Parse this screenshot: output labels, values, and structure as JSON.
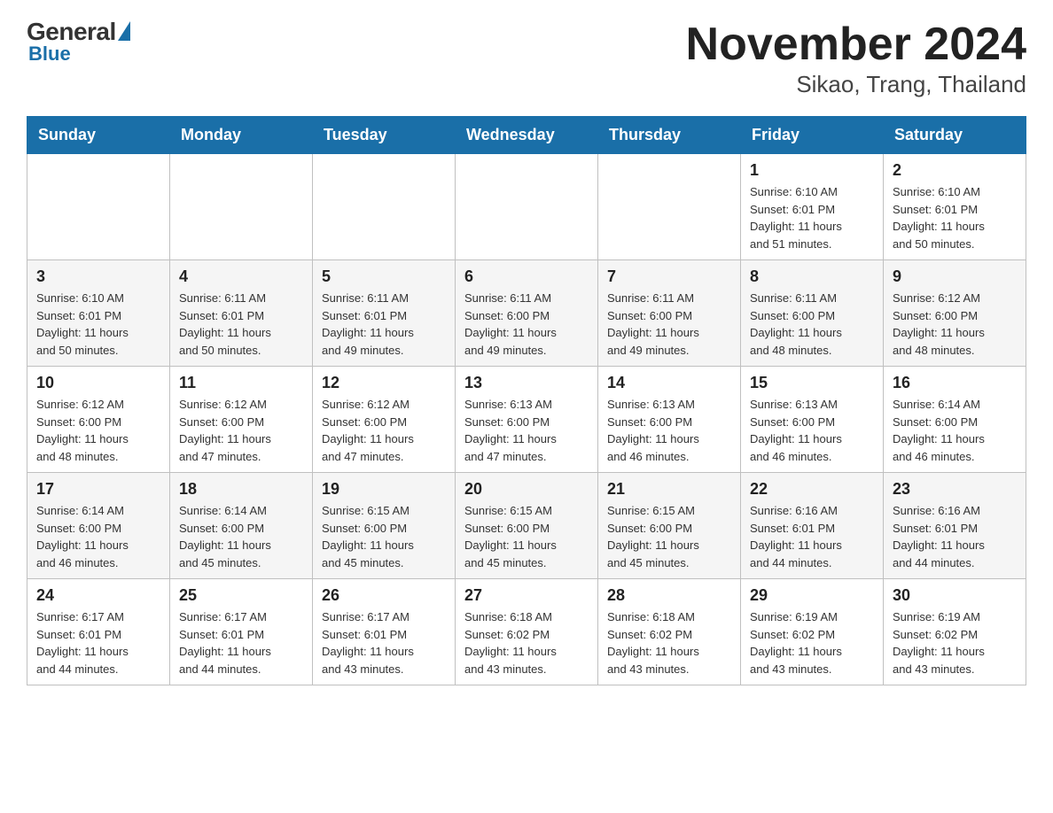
{
  "logo": {
    "general": "General",
    "blue": "Blue",
    "triangle": "▶"
  },
  "title": "November 2024",
  "subtitle": "Sikao, Trang, Thailand",
  "days_of_week": [
    "Sunday",
    "Monday",
    "Tuesday",
    "Wednesday",
    "Thursday",
    "Friday",
    "Saturday"
  ],
  "weeks": [
    [
      {
        "day": "",
        "info": ""
      },
      {
        "day": "",
        "info": ""
      },
      {
        "day": "",
        "info": ""
      },
      {
        "day": "",
        "info": ""
      },
      {
        "day": "",
        "info": ""
      },
      {
        "day": "1",
        "info": "Sunrise: 6:10 AM\nSunset: 6:01 PM\nDaylight: 11 hours\nand 51 minutes."
      },
      {
        "day": "2",
        "info": "Sunrise: 6:10 AM\nSunset: 6:01 PM\nDaylight: 11 hours\nand 50 minutes."
      }
    ],
    [
      {
        "day": "3",
        "info": "Sunrise: 6:10 AM\nSunset: 6:01 PM\nDaylight: 11 hours\nand 50 minutes."
      },
      {
        "day": "4",
        "info": "Sunrise: 6:11 AM\nSunset: 6:01 PM\nDaylight: 11 hours\nand 50 minutes."
      },
      {
        "day": "5",
        "info": "Sunrise: 6:11 AM\nSunset: 6:01 PM\nDaylight: 11 hours\nand 49 minutes."
      },
      {
        "day": "6",
        "info": "Sunrise: 6:11 AM\nSunset: 6:00 PM\nDaylight: 11 hours\nand 49 minutes."
      },
      {
        "day": "7",
        "info": "Sunrise: 6:11 AM\nSunset: 6:00 PM\nDaylight: 11 hours\nand 49 minutes."
      },
      {
        "day": "8",
        "info": "Sunrise: 6:11 AM\nSunset: 6:00 PM\nDaylight: 11 hours\nand 48 minutes."
      },
      {
        "day": "9",
        "info": "Sunrise: 6:12 AM\nSunset: 6:00 PM\nDaylight: 11 hours\nand 48 minutes."
      }
    ],
    [
      {
        "day": "10",
        "info": "Sunrise: 6:12 AM\nSunset: 6:00 PM\nDaylight: 11 hours\nand 48 minutes."
      },
      {
        "day": "11",
        "info": "Sunrise: 6:12 AM\nSunset: 6:00 PM\nDaylight: 11 hours\nand 47 minutes."
      },
      {
        "day": "12",
        "info": "Sunrise: 6:12 AM\nSunset: 6:00 PM\nDaylight: 11 hours\nand 47 minutes."
      },
      {
        "day": "13",
        "info": "Sunrise: 6:13 AM\nSunset: 6:00 PM\nDaylight: 11 hours\nand 47 minutes."
      },
      {
        "day": "14",
        "info": "Sunrise: 6:13 AM\nSunset: 6:00 PM\nDaylight: 11 hours\nand 46 minutes."
      },
      {
        "day": "15",
        "info": "Sunrise: 6:13 AM\nSunset: 6:00 PM\nDaylight: 11 hours\nand 46 minutes."
      },
      {
        "day": "16",
        "info": "Sunrise: 6:14 AM\nSunset: 6:00 PM\nDaylight: 11 hours\nand 46 minutes."
      }
    ],
    [
      {
        "day": "17",
        "info": "Sunrise: 6:14 AM\nSunset: 6:00 PM\nDaylight: 11 hours\nand 46 minutes."
      },
      {
        "day": "18",
        "info": "Sunrise: 6:14 AM\nSunset: 6:00 PM\nDaylight: 11 hours\nand 45 minutes."
      },
      {
        "day": "19",
        "info": "Sunrise: 6:15 AM\nSunset: 6:00 PM\nDaylight: 11 hours\nand 45 minutes."
      },
      {
        "day": "20",
        "info": "Sunrise: 6:15 AM\nSunset: 6:00 PM\nDaylight: 11 hours\nand 45 minutes."
      },
      {
        "day": "21",
        "info": "Sunrise: 6:15 AM\nSunset: 6:00 PM\nDaylight: 11 hours\nand 45 minutes."
      },
      {
        "day": "22",
        "info": "Sunrise: 6:16 AM\nSunset: 6:01 PM\nDaylight: 11 hours\nand 44 minutes."
      },
      {
        "day": "23",
        "info": "Sunrise: 6:16 AM\nSunset: 6:01 PM\nDaylight: 11 hours\nand 44 minutes."
      }
    ],
    [
      {
        "day": "24",
        "info": "Sunrise: 6:17 AM\nSunset: 6:01 PM\nDaylight: 11 hours\nand 44 minutes."
      },
      {
        "day": "25",
        "info": "Sunrise: 6:17 AM\nSunset: 6:01 PM\nDaylight: 11 hours\nand 44 minutes."
      },
      {
        "day": "26",
        "info": "Sunrise: 6:17 AM\nSunset: 6:01 PM\nDaylight: 11 hours\nand 43 minutes."
      },
      {
        "day": "27",
        "info": "Sunrise: 6:18 AM\nSunset: 6:02 PM\nDaylight: 11 hours\nand 43 minutes."
      },
      {
        "day": "28",
        "info": "Sunrise: 6:18 AM\nSunset: 6:02 PM\nDaylight: 11 hours\nand 43 minutes."
      },
      {
        "day": "29",
        "info": "Sunrise: 6:19 AM\nSunset: 6:02 PM\nDaylight: 11 hours\nand 43 minutes."
      },
      {
        "day": "30",
        "info": "Sunrise: 6:19 AM\nSunset: 6:02 PM\nDaylight: 11 hours\nand 43 minutes."
      }
    ]
  ]
}
